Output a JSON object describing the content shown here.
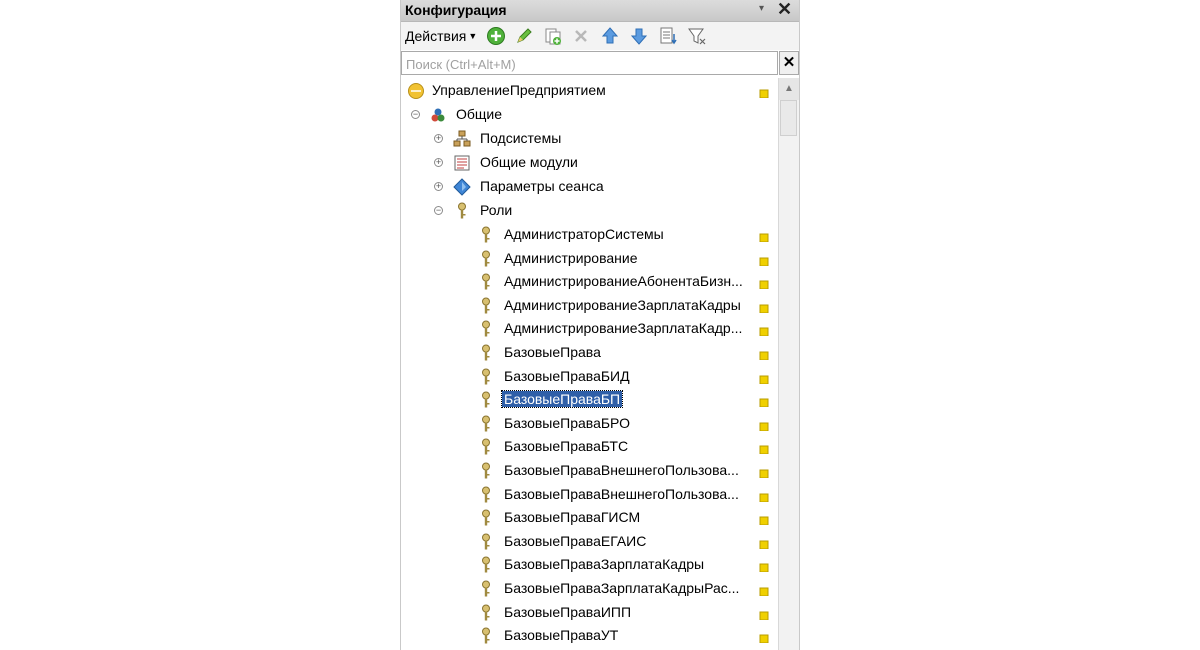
{
  "window": {
    "title": "Конфигурация"
  },
  "toolbar": {
    "actions_label": "Действия",
    "icons": [
      "add-icon",
      "edit-icon",
      "copy-icon",
      "delete-icon",
      "move-up-icon",
      "move-down-icon",
      "sort-icon",
      "filter-icon"
    ]
  },
  "search": {
    "placeholder": "Поиск (Ctrl+Alt+M)",
    "value": ""
  },
  "tree": {
    "root": "УправлениеПредприятием",
    "general": "Общие",
    "subsystems": "Подсистемы",
    "common_modules": "Общие модули",
    "session_params": "Параметры сеанса",
    "roles": "Роли",
    "role_items": [
      "АдминистраторСистемы",
      "Администрирование",
      "АдминистрированиеАбонентаБизн...",
      "АдминистрированиеЗарплатаКадры",
      "АдминистрированиеЗарплатаКадр...",
      "БазовыеПрава",
      "БазовыеПраваБИД",
      "БазовыеПраваБП",
      "БазовыеПраваБРО",
      "БазовыеПраваБТС",
      "БазовыеПраваВнешнегоПользова...",
      "БазовыеПраваВнешнегоПользова...",
      "БазовыеПраваГИСМ",
      "БазовыеПраваЕГАИС",
      "БазовыеПраваЗарплатаКадры",
      "БазовыеПраваЗарплатаКадрыРас...",
      "БазовыеПраваИПП",
      "БазовыеПраваУТ"
    ],
    "selected": "БазовыеПраваБП"
  }
}
